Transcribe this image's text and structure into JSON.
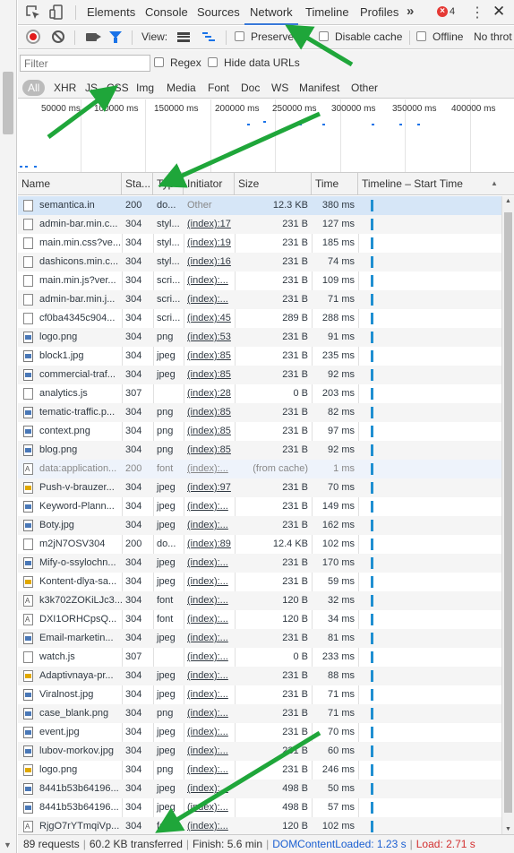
{
  "tabs": [
    {
      "label": "Elements"
    },
    {
      "label": "Console"
    },
    {
      "label": "Sources"
    },
    {
      "label": "Network"
    },
    {
      "label": "Timeline"
    },
    {
      "label": "Profiles"
    }
  ],
  "error_count": "4",
  "toolbar": {
    "view_label": "View:",
    "preserve_label": "Preserve",
    "disable_cache_label": "Disable cache",
    "offline_label": "Offline",
    "throttle_label": "No throt"
  },
  "filter": {
    "placeholder": "Filter",
    "regex_label": "Regex",
    "hide_data_urls_label": "Hide data URLs",
    "types": [
      "All",
      "XHR",
      "JS",
      "CSS",
      "Img",
      "Media",
      "Font",
      "Doc",
      "WS",
      "Manifest",
      "Other"
    ]
  },
  "overview": {
    "ticks": [
      "50000 ms",
      "100000 ms",
      "150000 ms",
      "200000 ms",
      "250000 ms",
      "300000 ms",
      "350000 ms",
      "400000 ms"
    ]
  },
  "table": {
    "headers": {
      "name": "Name",
      "status": "Sta...",
      "type": "Type",
      "initiator": "Initiator",
      "size": "Size",
      "time": "Time",
      "timeline": "Timeline – Start Time"
    },
    "rows": [
      {
        "name": "semantica.in",
        "status": "200",
        "type": "do...",
        "initiator": "Other",
        "size": "12.3 KB",
        "time": "380 ms"
      },
      {
        "name": "admin-bar.min.c...",
        "status": "304",
        "type": "styl...",
        "initiator": "(index):17",
        "size": "231 B",
        "time": "127 ms"
      },
      {
        "name": "main.min.css?ve...",
        "status": "304",
        "type": "styl...",
        "initiator": "(index):19",
        "size": "231 B",
        "time": "185 ms"
      },
      {
        "name": "dashicons.min.c...",
        "status": "304",
        "type": "styl...",
        "initiator": "(index):16",
        "size": "231 B",
        "time": "74 ms"
      },
      {
        "name": "main.min.js?ver...",
        "status": "304",
        "type": "scri...",
        "initiator": "(index):...",
        "size": "231 B",
        "time": "109 ms"
      },
      {
        "name": "admin-bar.min.j...",
        "status": "304",
        "type": "scri...",
        "initiator": "(index):...",
        "size": "231 B",
        "time": "71 ms"
      },
      {
        "name": "cf0ba4345c904...",
        "status": "304",
        "type": "scri...",
        "initiator": "(index):45",
        "size": "289 B",
        "time": "288 ms"
      },
      {
        "name": "logo.png",
        "status": "304",
        "type": "png",
        "initiator": "(index):53",
        "size": "231 B",
        "time": "91 ms"
      },
      {
        "name": "block1.jpg",
        "status": "304",
        "type": "jpeg",
        "initiator": "(index):85",
        "size": "231 B",
        "time": "235 ms"
      },
      {
        "name": "commercial-traf...",
        "status": "304",
        "type": "jpeg",
        "initiator": "(index):85",
        "size": "231 B",
        "time": "92 ms"
      },
      {
        "name": "analytics.js",
        "status": "307",
        "type": "",
        "initiator": "(index):28",
        "size": "0 B",
        "time": "203 ms"
      },
      {
        "name": "tematic-traffic.p...",
        "status": "304",
        "type": "png",
        "initiator": "(index):85",
        "size": "231 B",
        "time": "82 ms"
      },
      {
        "name": "context.png",
        "status": "304",
        "type": "png",
        "initiator": "(index):85",
        "size": "231 B",
        "time": "97 ms"
      },
      {
        "name": "blog.png",
        "status": "304",
        "type": "png",
        "initiator": "(index):85",
        "size": "231 B",
        "time": "92 ms"
      },
      {
        "name": "data:application...",
        "status": "200",
        "type": "font",
        "initiator": "(index):...",
        "size": "(from cache)",
        "time": "1 ms"
      },
      {
        "name": "Push-v-brauzer...",
        "status": "304",
        "type": "jpeg",
        "initiator": "(index):97",
        "size": "231 B",
        "time": "70 ms"
      },
      {
        "name": "Keyword-Plann...",
        "status": "304",
        "type": "jpeg",
        "initiator": "(index):...",
        "size": "231 B",
        "time": "149 ms"
      },
      {
        "name": "Boty.jpg",
        "status": "304",
        "type": "jpeg",
        "initiator": "(index):...",
        "size": "231 B",
        "time": "162 ms"
      },
      {
        "name": "m2jN7OSV304",
        "status": "200",
        "type": "do...",
        "initiator": "(index):89",
        "size": "12.4 KB",
        "time": "102 ms"
      },
      {
        "name": "Mify-o-ssylochn...",
        "status": "304",
        "type": "jpeg",
        "initiator": "(index):...",
        "size": "231 B",
        "time": "170 ms"
      },
      {
        "name": "Kontent-dlya-sa...",
        "status": "304",
        "type": "jpeg",
        "initiator": "(index):...",
        "size": "231 B",
        "time": "59 ms"
      },
      {
        "name": "k3k702ZOKiLJc3...",
        "status": "304",
        "type": "font",
        "initiator": "(index):...",
        "size": "120 B",
        "time": "32 ms"
      },
      {
        "name": "DXI1ORHCpsQ...",
        "status": "304",
        "type": "font",
        "initiator": "(index):...",
        "size": "120 B",
        "time": "34 ms"
      },
      {
        "name": "Email-marketin...",
        "status": "304",
        "type": "jpeg",
        "initiator": "(index):...",
        "size": "231 B",
        "time": "81 ms"
      },
      {
        "name": "watch.js",
        "status": "307",
        "type": "",
        "initiator": "(index):...",
        "size": "0 B",
        "time": "233 ms"
      },
      {
        "name": "Adaptivnaya-pr...",
        "status": "304",
        "type": "jpeg",
        "initiator": "(index):...",
        "size": "231 B",
        "time": "88 ms"
      },
      {
        "name": "Viralnost.jpg",
        "status": "304",
        "type": "jpeg",
        "initiator": "(index):...",
        "size": "231 B",
        "time": "71 ms"
      },
      {
        "name": "case_blank.png",
        "status": "304",
        "type": "png",
        "initiator": "(index):...",
        "size": "231 B",
        "time": "71 ms"
      },
      {
        "name": "event.jpg",
        "status": "304",
        "type": "jpeg",
        "initiator": "(index):...",
        "size": "231 B",
        "time": "70 ms"
      },
      {
        "name": "lubov-morkov.jpg",
        "status": "304",
        "type": "jpeg",
        "initiator": "(index):...",
        "size": "231 B",
        "time": "60 ms"
      },
      {
        "name": "logo.png",
        "status": "304",
        "type": "png",
        "initiator": "(index):...",
        "size": "231 B",
        "time": "246 ms"
      },
      {
        "name": "8441b53b64196...",
        "status": "304",
        "type": "jpeg",
        "initiator": "(index):...",
        "size": "498 B",
        "time": "50 ms"
      },
      {
        "name": "8441b53b64196...",
        "status": "304",
        "type": "jpeg",
        "initiator": "(index):...",
        "size": "498 B",
        "time": "57 ms"
      },
      {
        "name": "RjgO7rYTmqiVp...",
        "status": "304",
        "type": "font",
        "initiator": "(index):...",
        "size": "120 B",
        "time": "102 ms"
      }
    ]
  },
  "status": {
    "requests": "89 requests",
    "transferred": "60.2 KB transferred",
    "finish": "Finish: 5.6 min",
    "dcl": "DOMContentLoaded: 1.23 s",
    "load": "Load: 2.71 s"
  },
  "colors": {
    "accent": "#1a73e8",
    "arrow": "#1fa63a",
    "load": "#d32f2f",
    "dcl": "#1a5fd1"
  }
}
